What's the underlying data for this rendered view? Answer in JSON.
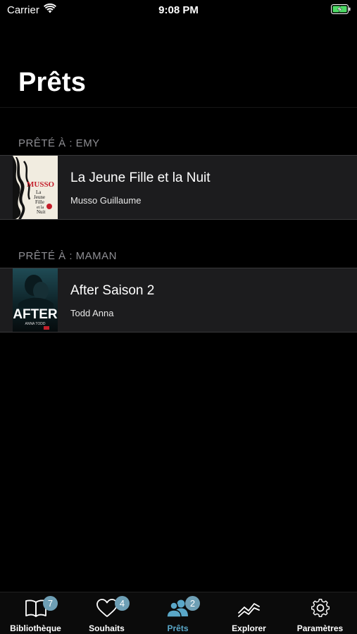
{
  "status_bar": {
    "carrier": "Carrier",
    "time": "9:08 PM"
  },
  "page": {
    "title": "Prêts"
  },
  "sections": [
    {
      "header": "PRÊTÉ À : EMY",
      "items": [
        {
          "title": "La Jeune Fille et la Nuit",
          "author": "Musso Guillaume",
          "cover": {
            "top_text": "MUSSO",
            "sub_text": "La Jeune Fille et la Nuit"
          }
        }
      ]
    },
    {
      "header": "PRÊTÉ À : MAMAN",
      "items": [
        {
          "title": "After Saison 2",
          "author": "Todd Anna",
          "cover": {
            "top_text": "AFTER",
            "sub_text": "ANNA TODD"
          }
        }
      ]
    }
  ],
  "tab_bar": {
    "accent_color": "#5aa7c8",
    "badge_color": "#6e9fb5",
    "tabs": [
      {
        "label": "Bibliothèque",
        "icon": "book-icon",
        "badge": "7",
        "active": false
      },
      {
        "label": "Souhaits",
        "icon": "heart-icon",
        "badge": "4",
        "active": false
      },
      {
        "label": "Prêts",
        "icon": "people-icon",
        "badge": "2",
        "active": true
      },
      {
        "label": "Explorer",
        "icon": "trend-chart-icon",
        "badge": "",
        "active": false
      },
      {
        "label": "Paramètres",
        "icon": "gear-icon",
        "badge": "",
        "active": false
      }
    ]
  }
}
